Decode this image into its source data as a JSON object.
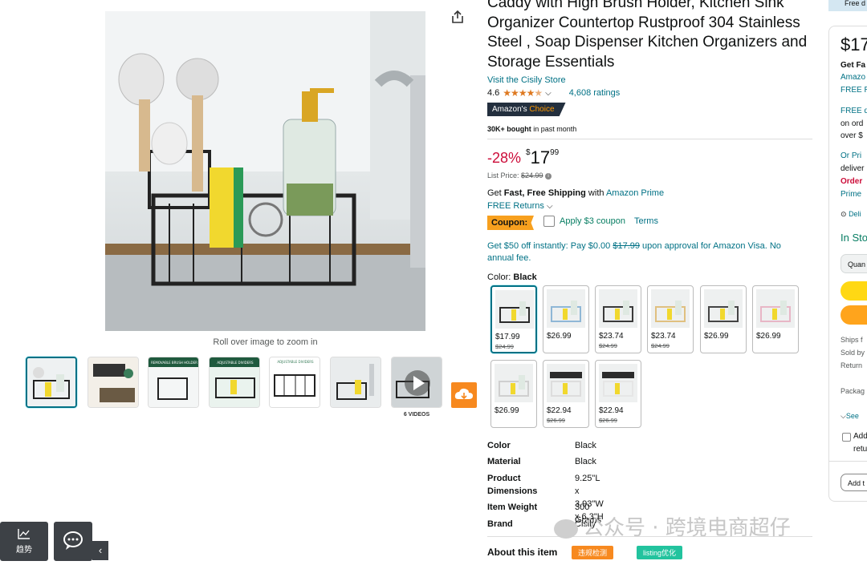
{
  "gallery": {
    "zoom_hint": "Roll over image to zoom in",
    "video_count_label": "6 VIDEOS",
    "thumb_texts": [
      "REMOVABLE BRUSH HOLDER",
      "ADJUSTABLE DIVIDERS",
      "ADJUSTABLE DIVIDERS"
    ]
  },
  "product": {
    "title": "Caddy with High Brush Holder, Kitchen Sink Organizer Countertop Rustproof 304 Stainless Steel , Soap Dispenser Kitchen Organizers and Storage Essentials",
    "store_link": "Visit the Cisily Store",
    "rating": "4.6",
    "ratings_count": "4,608 ratings",
    "badge_main": "Amazon's",
    "badge_accent": "Choice",
    "bought_bold": "30K+ bought",
    "bought_rest": " in past month"
  },
  "price": {
    "discount": "-28%",
    "currency": "$",
    "whole": "17",
    "fraction": "99",
    "list_label": "List Price: ",
    "list_value": "$24.99"
  },
  "shipping": {
    "get": "Get ",
    "bold": "Fast, Free Shipping",
    "with": " with ",
    "prime_link": "Amazon Prime",
    "returns": "FREE Returns"
  },
  "coupon": {
    "badge": "Coupon:",
    "apply": "Apply $3 coupon",
    "terms": "Terms"
  },
  "visa_offer": {
    "text1": "Get $50 off instantly: Pay $0.00 ",
    "strike": "$17.99",
    "text2": " upon approval for Amazon Visa. No annual fee."
  },
  "color": {
    "label": "Color: ",
    "selected": "Black",
    "swatches": [
      {
        "price": "$17.99",
        "old": "$24.99",
        "tint": "#2b2b2b"
      },
      {
        "price": "$26.99",
        "old": "",
        "tint": "#8fb7d6"
      },
      {
        "price": "$23.74",
        "old": "$24.99",
        "tint": "#3a3a3a"
      },
      {
        "price": "$23.74",
        "old": "$24.99",
        "tint": "#e0c080"
      },
      {
        "price": "$26.99",
        "old": "",
        "tint": "#444444"
      },
      {
        "price": "$26.99",
        "old": "",
        "tint": "#e8b6c6"
      },
      {
        "price": "$26.99",
        "old": "",
        "tint": "#f2f2f2"
      },
      {
        "price": "$22.94",
        "old": "$26.99",
        "tint": "#f0f0f0"
      },
      {
        "price": "$22.94",
        "old": "$26.99",
        "tint": "#fafafa"
      }
    ]
  },
  "specs": [
    {
      "k": "Color",
      "v": "Black"
    },
    {
      "k": "Material",
      "v": "Black"
    },
    {
      "k": "Product Dimensions",
      "v": "9.25\"L x 3.93\"W x 6.3\"H"
    },
    {
      "k": "Item Weight",
      "v": "300 Grams"
    },
    {
      "k": "Brand",
      "v": "Cisily"
    }
  ],
  "about": {
    "heading": "About this item",
    "tag1": "违规检测",
    "tag2": "listing优化"
  },
  "watermark": "公众号 · 跨境电商超仔",
  "floating": {
    "trend": "趋势"
  },
  "buybox": {
    "free_del": "Free d",
    "price": "$17",
    "lines": [
      "Get Fa",
      "Amazo",
      "FREE R",
      "FREE d",
      "on ord",
      "over $",
      "Or Pri",
      "deliver",
      "Order",
      "Prime",
      "Deli",
      "In Sto",
      "Quan",
      "Ships f",
      "Sold by",
      "Return",
      "Packag",
      "See",
      "Add",
      "retu",
      "Add t"
    ]
  },
  "colors": {
    "link": "#007185",
    "deal_red": "#cc0c39",
    "coupon_orange": "#f7a01e",
    "green": "#067d62",
    "buy_yellow": "#ffd814",
    "buy_orange": "#ffa41c"
  }
}
